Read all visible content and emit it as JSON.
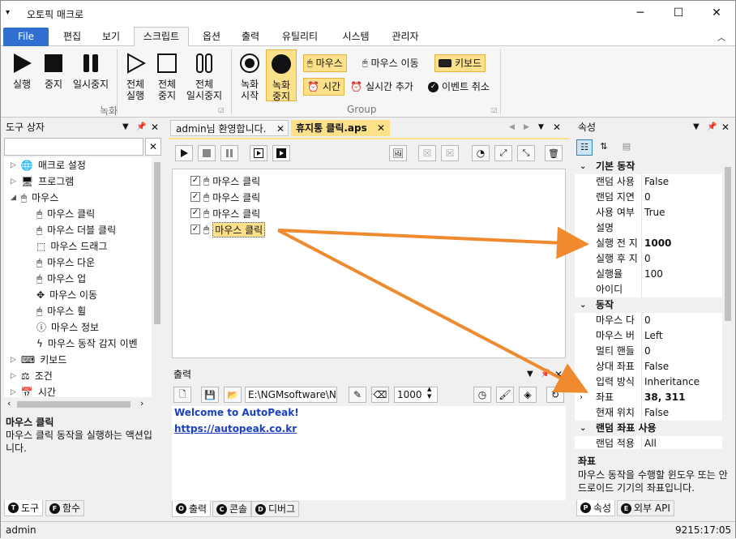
{
  "window": {
    "title": "오토픽 매크로",
    "minimize": "─",
    "maximize": "☐",
    "close": "✕"
  },
  "ribbon": {
    "file_tab": "File",
    "tabs": [
      "편집",
      "보기",
      "스크립트",
      "옵션",
      "출력",
      "유틸리티",
      "시스템",
      "관리자"
    ],
    "active_tab": "스크립트",
    "rec_group": {
      "label": "녹화",
      "play": "실행",
      "stop": "중지",
      "pause": "일시중지",
      "play_all": [
        "전체",
        "실행"
      ],
      "stop_all": [
        "전체",
        "중지"
      ],
      "pause_all": [
        "전체",
        "일시중지"
      ]
    },
    "group": {
      "label": "Group",
      "rec_start": [
        "녹화",
        "시작"
      ],
      "rec_stop": [
        "녹화",
        "중지"
      ],
      "mouse": "마우스",
      "mouse_move": "마우스 이동",
      "keyboard": "키보드",
      "time": "시간",
      "realtime_add": "실시간 추가",
      "event_cancel": "이벤트 취소"
    }
  },
  "toolbox": {
    "title": "도구 상자",
    "search_placeholder": "",
    "items": [
      {
        "label": "매크로 설정",
        "level": 0
      },
      {
        "label": "프로그램",
        "level": 0
      },
      {
        "label": "마우스",
        "level": 0
      },
      {
        "label": "마우스 클릭",
        "level": 1
      },
      {
        "label": "마우스 더블 클릭",
        "level": 1
      },
      {
        "label": "마우스 드래그",
        "level": 1
      },
      {
        "label": "마우스 다운",
        "level": 1
      },
      {
        "label": "마우스 업",
        "level": 1
      },
      {
        "label": "마우스 이동",
        "level": 1
      },
      {
        "label": "마우스 휠",
        "level": 1
      },
      {
        "label": "마우스 정보",
        "level": 1
      },
      {
        "label": "마우스 동작 감지 이벤",
        "level": 1
      },
      {
        "label": "키보드",
        "level": 0
      },
      {
        "label": "조건",
        "level": 0
      },
      {
        "label": "시간",
        "level": 0
      }
    ],
    "desc_title": "마우스 클릭",
    "desc_text": "마우스 클릭 동작을 실행하는 액션입니다.",
    "tabs": [
      {
        "icon": "T",
        "label": "도구"
      },
      {
        "icon": "F",
        "label": "함수"
      }
    ]
  },
  "editor": {
    "tabs": [
      {
        "label": "admin님 환영합니다.",
        "active": false
      },
      {
        "label": "휴지통 클릭.aps",
        "active": true
      }
    ],
    "lines": [
      "마우스 클릭",
      "마우스 클릭",
      "마우스 클릭",
      "마우스 클릭"
    ],
    "selected_line": 3
  },
  "output": {
    "title": "출력",
    "path": "E:\\NGMsoftware\\NG",
    "interval": "1000",
    "welcome": "Welcome to AutoPeak!",
    "link": "https://autopeak.co.kr",
    "tabs": [
      {
        "icon": "O",
        "label": "출력"
      },
      {
        "icon": "C",
        "label": "콘솔"
      },
      {
        "icon": "D",
        "label": "디버그"
      }
    ]
  },
  "properties": {
    "title": "속성",
    "rows": [
      {
        "cat": true,
        "k": "기본 동작"
      },
      {
        "k": "랜덤 사용",
        "v": "False"
      },
      {
        "k": "랜덤 지연",
        "v": "0"
      },
      {
        "k": "사용 여부",
        "v": "True"
      },
      {
        "k": "설명",
        "v": ""
      },
      {
        "k": "실행 전 지",
        "v": "1000",
        "bold": true
      },
      {
        "k": "실행 후 지",
        "v": "0"
      },
      {
        "k": "실행율",
        "v": "100"
      },
      {
        "k": "아이디",
        "v": ""
      },
      {
        "cat": true,
        "k": "동작"
      },
      {
        "k": "마우스 다",
        "v": "0"
      },
      {
        "k": "마우스 버",
        "v": "Left"
      },
      {
        "k": "멀티 핸들",
        "v": "0"
      },
      {
        "k": "상대 좌표",
        "v": "False"
      },
      {
        "k": "입력 방식",
        "v": "Inheritance"
      },
      {
        "k": "좌표",
        "v": "38, 311",
        "bold": true,
        "expand": true
      },
      {
        "k": "현재 위치",
        "v": "False"
      },
      {
        "cat": true,
        "k": "랜덤 좌표 사용"
      },
      {
        "k": "랜덤 적용",
        "v": "All"
      }
    ],
    "desc_title": "좌표",
    "desc_text": "마우스 동작을 수행할 윈도우 또는 안드로이드 기기의 좌표입니다.",
    "tabs": [
      {
        "icon": "P",
        "label": "속성"
      },
      {
        "icon": "E",
        "label": "외부 API"
      }
    ]
  },
  "status": {
    "user": "admin",
    "time": "9215:17:05"
  },
  "colors": {
    "accent": "#2f6fd1",
    "highlight": "#fde08a",
    "arrow": "#f08a2e",
    "link": "#1a3fbf"
  }
}
